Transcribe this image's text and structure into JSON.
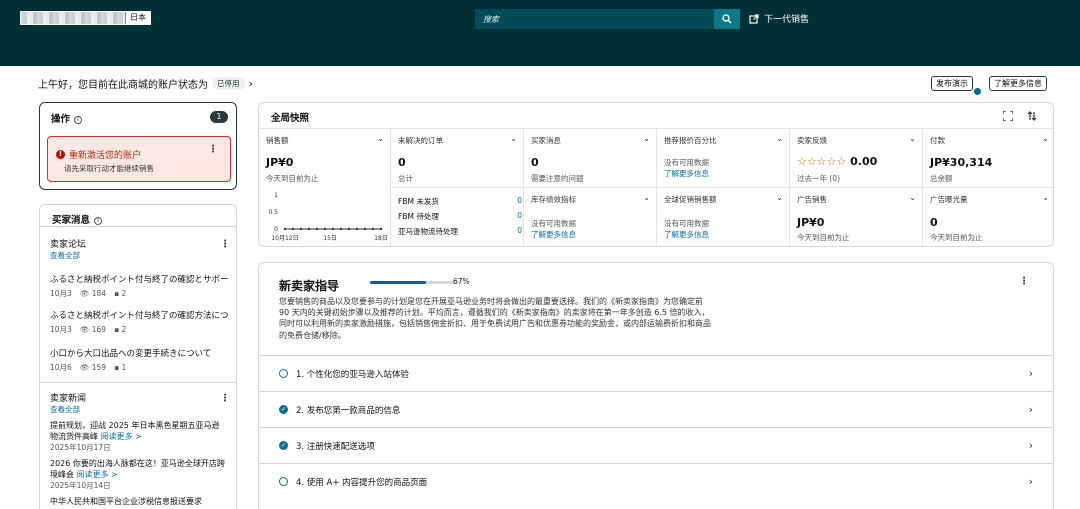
{
  "topbar": {
    "region": "日本",
    "search_placeholder": "搜索",
    "next_gen": "下一代销售"
  },
  "greeting": {
    "text": "上午好，您目前在此商城的账户状态为",
    "status": "已停用",
    "chevron": "›"
  },
  "header_buttons": {
    "publish_demo": "发布演示",
    "learn_more": "了解更多信息"
  },
  "operations": {
    "title": "操作",
    "badge": "1",
    "alert_title": "重新激活您的账户",
    "alert_sub": "请先采取行动才能继续销售"
  },
  "messages": {
    "title": "买家消息",
    "forum": {
      "title": "卖家论坛",
      "see_all": "查看全部",
      "posts": [
        {
          "title": "ふるさと納税ポイント付与終了の確認とサポート",
          "date": "10月3",
          "views": "184",
          "comments": "2"
        },
        {
          "title": "ふるさと納税ポイント付与終了の確認方法について",
          "date": "10月3",
          "views": "169",
          "comments": "2"
        },
        {
          "title": "小口から大口出品への変更手続きについて",
          "date": "10月6",
          "views": "159",
          "comments": "1"
        }
      ]
    },
    "news": {
      "title": "卖家新闻",
      "see_all": "查看全部",
      "items": [
        {
          "text": "提前规划，迎战 2025 年日本黑色星期五亚马逊物流货件高峰",
          "more": "阅读更多 >",
          "date": "2025年10月17日"
        },
        {
          "text": "2026 你要的出海人脉都在这！亚马逊全球开店跨境峰会",
          "more": "阅读更多 >",
          "date": "2025年10月14日"
        },
        {
          "text": "中华人民共和国平台企业涉税信息报送要求",
          "more": "",
          "date": ""
        }
      ]
    }
  },
  "snapshot": {
    "title": "全局快照",
    "tiles": {
      "sales": {
        "header": "销售额",
        "value": "JP¥0",
        "sub": "今天到目前为止"
      },
      "orders": {
        "header": "未解决的订单",
        "value": "0",
        "sub": "总计"
      },
      "buyer_msgs": {
        "header": "买家消息",
        "value": "0",
        "sub": "需要注意的问题"
      },
      "featured_offer": {
        "header": "推荐报价百分比",
        "sub": "没有可用数据",
        "link": "了解更多信息"
      },
      "feedback": {
        "header": "卖家反馈",
        "value": "0.00",
        "sub": "过去一年 (0)"
      },
      "payments": {
        "header": "付款",
        "value": "JP¥30,314",
        "sub": "总余额"
      },
      "inventory": {
        "header": "库存绩效指标",
        "sub": "没有可用数据",
        "link": "了解更多信息"
      },
      "global_promo": {
        "header": "全球促销销售额",
        "sub": "没有可用数据",
        "link": "了解更多信息"
      },
      "ad_sales": {
        "header": "广告销售",
        "value": "JP¥0",
        "sub": "今天到目前为止"
      },
      "ad_impressions": {
        "header": "广告曝光量",
        "value": "0",
        "sub": "今天到目前为止"
      }
    },
    "fbm": [
      {
        "label": "FBM 未发货",
        "value": "0"
      },
      {
        "label": "FBM 待处理",
        "value": "0"
      },
      {
        "label": "亚马逊物流待处理",
        "value": "0"
      }
    ],
    "mini_chart": {
      "y_ticks": [
        "1",
        "0.5",
        "0"
      ],
      "x_ticks": [
        "10月12日",
        "15日",
        "18日"
      ],
      "values": [
        0,
        0,
        0,
        0,
        0,
        0,
        0,
        0,
        0,
        0,
        0,
        0,
        0
      ]
    }
  },
  "guide": {
    "title": "新卖家指导",
    "progress": 67,
    "progress_label": "67%",
    "desc": "您要销售的商品以及您要参与的计划是您在开展亚马逊业务时将会做出的最重要选择。我们的《新卖家指南》为您确定前 90 天内的关键初始步骤以及推荐的计划。平均而言，遵循我们的《新卖家指南》的卖家将在第一年多创造 6.5 倍的收入，同时可以利用新的卖家激励措施，包括销售佣金折扣、用于免费试用广告和优惠券功能的奖励金，或内部运输费折扣和商品的免费仓储/移除。",
    "steps": [
      {
        "label": "1. 个性化您的亚马逊入站体验",
        "done": false
      },
      {
        "label": "2. 发布您第一款商品的信息",
        "done": true
      },
      {
        "label": "3. 注册快速配送选项",
        "done": true
      },
      {
        "label": "4. 使用 A+ 内容提升您的商品页面",
        "done": false
      }
    ]
  }
}
